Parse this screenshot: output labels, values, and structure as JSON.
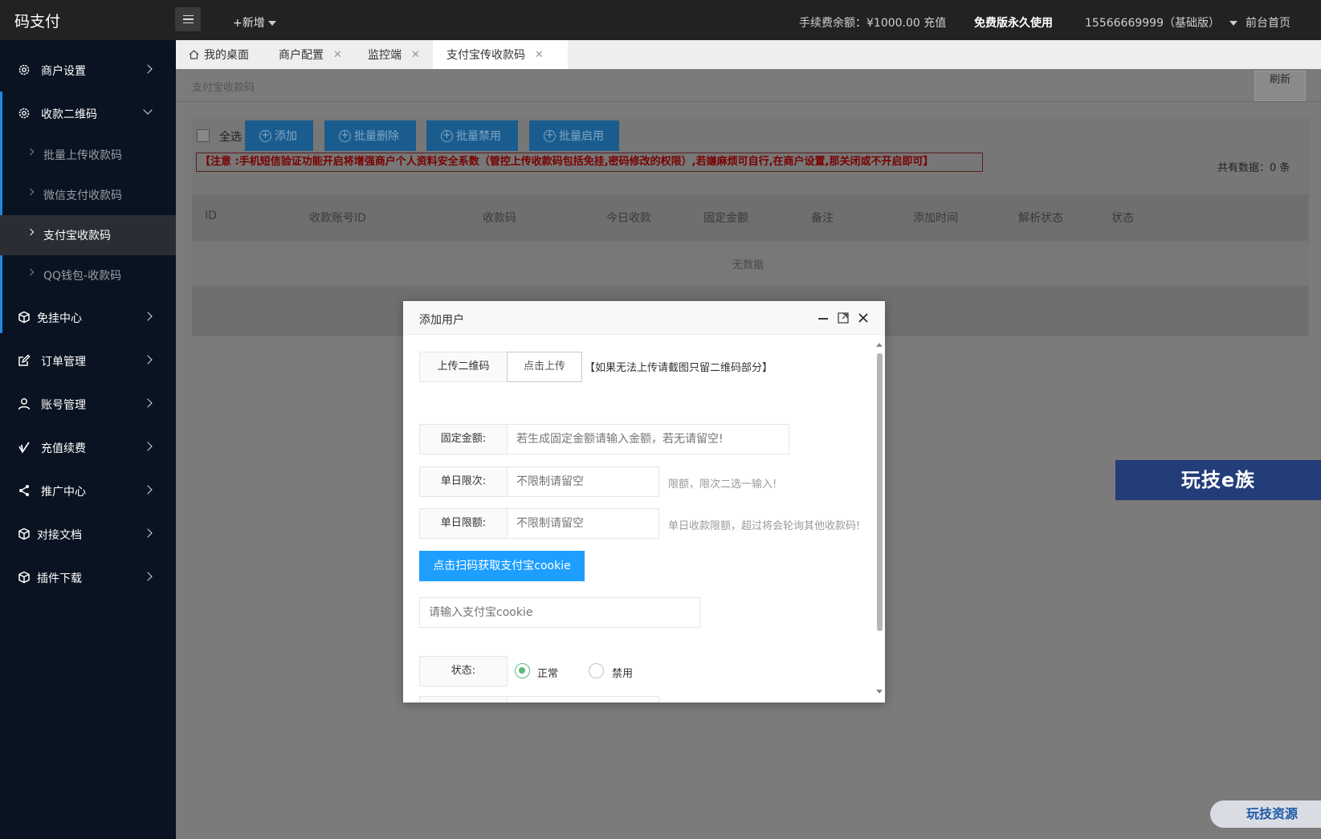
{
  "topbar": {
    "logo": "码支付",
    "new_label": "+新增",
    "fee": "手续费余额：¥1000.00 充值",
    "free": "免费版永久使用",
    "account": "15566669999（基础版）",
    "front": "前台首页"
  },
  "sidebar": {
    "items": [
      {
        "label": "商户设置",
        "icon": "gear-icon"
      },
      {
        "label": "收款二维码",
        "icon": "gear-icon"
      },
      {
        "label": "免挂中心",
        "icon": "cube-icon"
      },
      {
        "label": "订单管理",
        "icon": "edit-icon"
      },
      {
        "label": "账号管理",
        "icon": "user-icon"
      },
      {
        "label": "充值续费",
        "icon": "check-icon"
      },
      {
        "label": "推广中心",
        "icon": "share-icon"
      },
      {
        "label": "对接文档",
        "icon": "cube-icon"
      },
      {
        "label": "插件下载",
        "icon": "cube-icon"
      }
    ],
    "subitems": [
      {
        "label": "批量上传收款码"
      },
      {
        "label": "微信支付收款码"
      },
      {
        "label": "支付宝收款码"
      },
      {
        "label": "QQ钱包-收款码"
      }
    ]
  },
  "tabs": [
    {
      "label": "我的桌面"
    },
    {
      "label": "商户配置"
    },
    {
      "label": "监控端"
    },
    {
      "label": "支付宝传收款码"
    }
  ],
  "content": {
    "breadcrumb": "支付宝收款码",
    "refresh": "刷新",
    "select_all": "全选",
    "buttons": [
      "添加",
      "批量删除",
      "批量禁用",
      "批量启用"
    ],
    "notice": "【注意 :手机短信验证功能开启将增强商户个人资料安全系数（管控上传收款码包括免挂,密码修改的权限）,若嫌麻烦可自行,在商户设置,那关闭或不开启即可】",
    "total": "共有数据：0 条",
    "columns": [
      "ID",
      "收款账号ID",
      "收款码",
      "今日收款",
      "固定金额",
      "备注",
      "添加时间",
      "解析状态",
      "状态"
    ],
    "no_data": "无数据"
  },
  "watermarks": {
    "banner": "玩技e族",
    "corner": "玩技资源"
  },
  "modal": {
    "title": "添加用户",
    "upload_label": "上传二维码",
    "upload_button": "点击上传",
    "upload_hint": "【如果无法上传请截图只留二维码部分】",
    "fixed_amount_label": "固定金额:",
    "fixed_amount_placeholder": "若生成固定金额请输入金额，若无请留空!",
    "daily_count_label": "单日限次:",
    "daily_count_placeholder": "不限制请留空",
    "daily_count_hint": "限额，限次二选一输入!",
    "daily_limit_label": "单日限额:",
    "daily_limit_placeholder": "不限制请留空",
    "daily_limit_hint": "单日收款限额，超过将会轮询其他收款码!",
    "scan_button": "点击扫码获取支付宝cookie",
    "cookie_placeholder": "请输入支付宝cookie",
    "status_label": "状态:",
    "status_normal": "正常",
    "status_disabled": "禁用",
    "status_selected": "正常"
  },
  "colors": {
    "accent": "#1e9fff",
    "radio_on": "#5fb878",
    "sidebar_bg": "#0a1321",
    "topbar_bg": "#222222"
  }
}
